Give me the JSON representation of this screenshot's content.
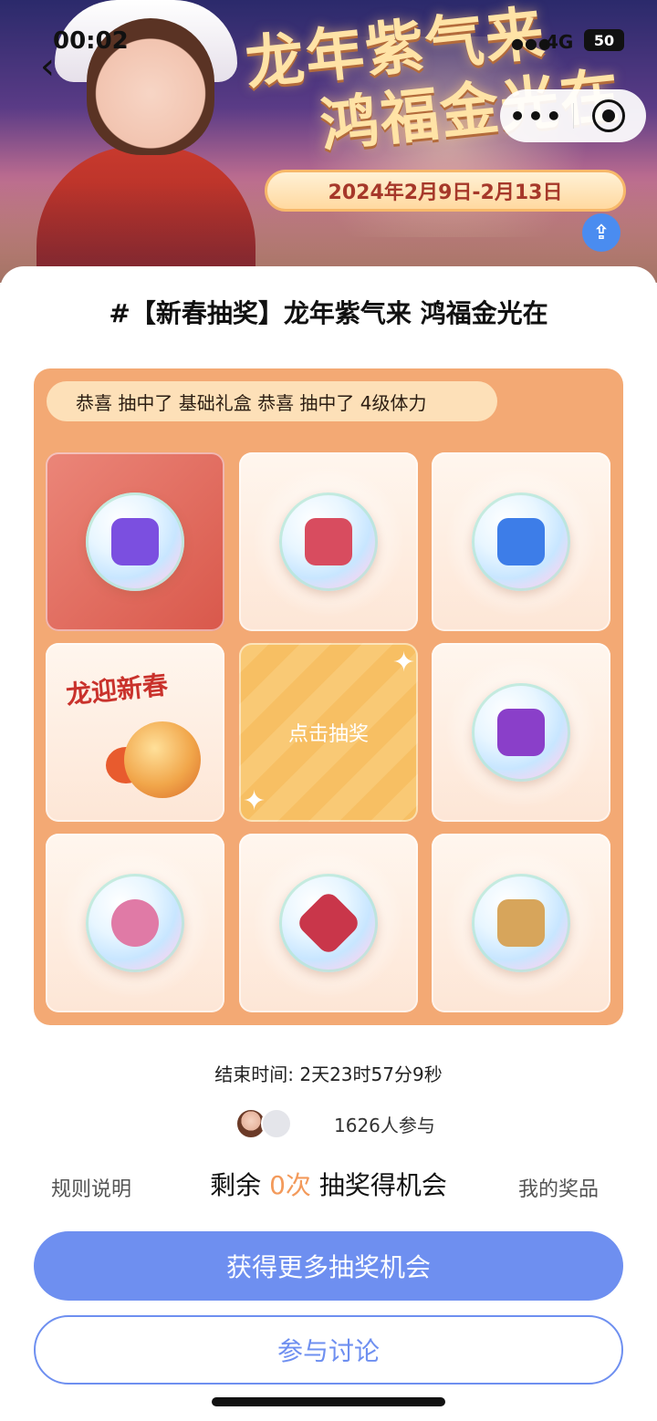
{
  "statusbar": {
    "time": "00:02",
    "network": "4G",
    "battery": "50"
  },
  "nav": {
    "back_icon": "chevron-left-icon",
    "more_icon": "more-dots-icon",
    "target_icon": "target-icon",
    "share_icon": "share-icon"
  },
  "banner": {
    "title_line1": "龙年紫气来",
    "title_line2": "鸿福金光在",
    "date_range": "2024年2月9日-2月13日"
  },
  "post": {
    "title": "#【新春抽奖】龙年紫气来 鸿福金光在"
  },
  "ticker": {
    "text": "恭喜 抽中了 基础礼盒  恭喜 抽中了 4级体力"
  },
  "grid": {
    "center_label": "点击抽奖",
    "dragon_card_text": "龙迎新春",
    "items": [
      {
        "name": "purple-crystal-orb",
        "color": "#7b4fe0"
      },
      {
        "name": "red-crystal-orb",
        "color": "#d84c5f"
      },
      {
        "name": "blue-treasure-chest",
        "color": "#3d7de8"
      },
      {
        "name": "dragon-new-year-card",
        "color": "#c9322c"
      },
      {
        "name": "purple-treasure-chest",
        "color": "#8a3fc9"
      },
      {
        "name": "pink-piggy-bank",
        "color": "#e07aa6"
      },
      {
        "name": "red-gems",
        "color": "#c9364a"
      },
      {
        "name": "gift-basket",
        "color": "#d7a55b"
      }
    ]
  },
  "footer": {
    "end_time": "结束时间: 2天23时57分9秒",
    "participants": "1626人参与",
    "rules_label": "规则说明",
    "prizes_label": "我的奖品",
    "remaining_prefix": "剩余",
    "remaining_count": "0次",
    "remaining_suffix": "抽奖得机会",
    "primary_button": "获得更多抽奖机会",
    "secondary_button": "参与讨论"
  },
  "colors": {
    "accent": "#6e8ff0",
    "grid_bg": "#f3a974",
    "highlight": "#f39a5b"
  }
}
